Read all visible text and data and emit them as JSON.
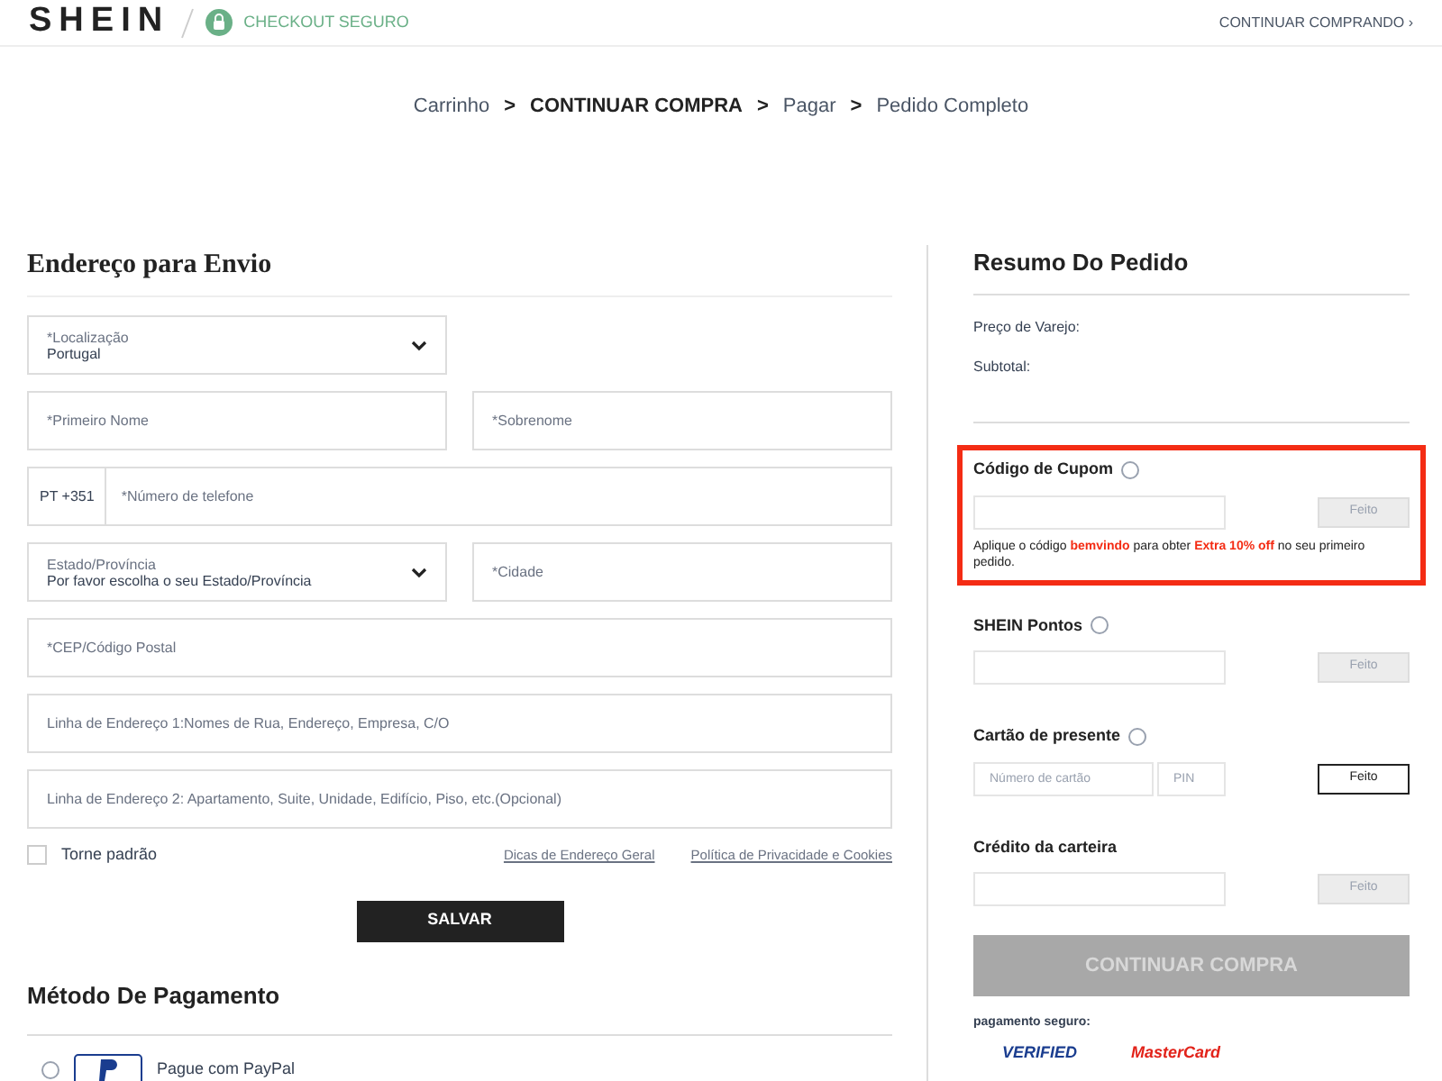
{
  "header": {
    "logo": "SHEIN",
    "secure_label": "CHECKOUT SEGURO",
    "continue_link": "CONTINUAR COMPRANDO",
    "continue_arrow": "›"
  },
  "breadcrumb": {
    "separator": ">",
    "steps": [
      {
        "label": "Carrinho",
        "selected": false
      },
      {
        "label": "CONTINUAR COMPRA",
        "selected": true
      },
      {
        "label": "Pagar",
        "selected": false
      },
      {
        "label": "Pedido Completo",
        "selected": false
      }
    ]
  },
  "shipping": {
    "title": "Endereço para Envio",
    "rows": [
      [
        {
          "kind": "select",
          "label": "*Localização",
          "value": "Portugal"
        }
      ],
      [
        {
          "kind": "text",
          "placeholder": "*Primeiro Nome"
        },
        {
          "kind": "text",
          "placeholder": "*Sobrenome"
        }
      ],
      [
        {
          "kind": "phone",
          "prefix": "PT +351",
          "placeholder": "*Número de telefone"
        }
      ],
      [
        {
          "kind": "select",
          "label": "Estado/Província",
          "value": "Por favor escolha o seu Estado/Província"
        },
        {
          "kind": "text",
          "placeholder": "*Cidade"
        }
      ],
      [
        {
          "kind": "text",
          "placeholder": "*CEP/Código Postal"
        }
      ],
      [
        {
          "kind": "text",
          "placeholder": "Linha de Endereço 1:Nomes de Rua, Endereço, Empresa, C/O"
        }
      ],
      [
        {
          "kind": "text",
          "placeholder": "Linha de Endereço 2: Apartamento, Suite, Unidade, Edifício, Piso, etc.(Opcional)"
        }
      ]
    ],
    "default_checkbox": {
      "label": "Torne padrão",
      "checked": false
    },
    "links": [
      "Dicas de Endereço Geral",
      "Política de Privacidade e Cookies"
    ],
    "save_button": "SALVAR"
  },
  "payment": {
    "title": "Método De Pagamento",
    "options": [
      {
        "label": "Pague com PayPal",
        "selected": false
      }
    ]
  },
  "summary": {
    "title": "Resumo Do Pedido",
    "lines": [
      "Preço de Varejo:",
      "Subtotal:"
    ],
    "sections": [
      {
        "title": "Código de Cupom",
        "help": true,
        "highlighted": true,
        "button": {
          "label": "Feito",
          "disabled": true
        },
        "note": "Aplique o código **bemvindo** para obter **Extra 10% off** no seu primeiro pedido."
      },
      {
        "title": "SHEIN Pontos",
        "help": true,
        "highlighted": false,
        "button": {
          "label": "Feito",
          "disabled": true
        }
      },
      {
        "title": "Cartão de presente",
        "help": true,
        "highlighted": false,
        "inputs": [
          {
            "placeholder": "Número de cartão"
          },
          {
            "placeholder": "PIN"
          }
        ],
        "button": {
          "label": "Feito",
          "disabled": false
        }
      },
      {
        "title": "Crédito da carteira",
        "help": false,
        "highlighted": false,
        "button": {
          "label": "Feito",
          "disabled": true
        }
      }
    ],
    "continue_button": {
      "label": "CONTINUAR COMPRA",
      "disabled": true
    },
    "secure_payment": "pagamento seguro:",
    "payment_logos": [
      "VERIFIED",
      "MasterCard"
    ]
  }
}
